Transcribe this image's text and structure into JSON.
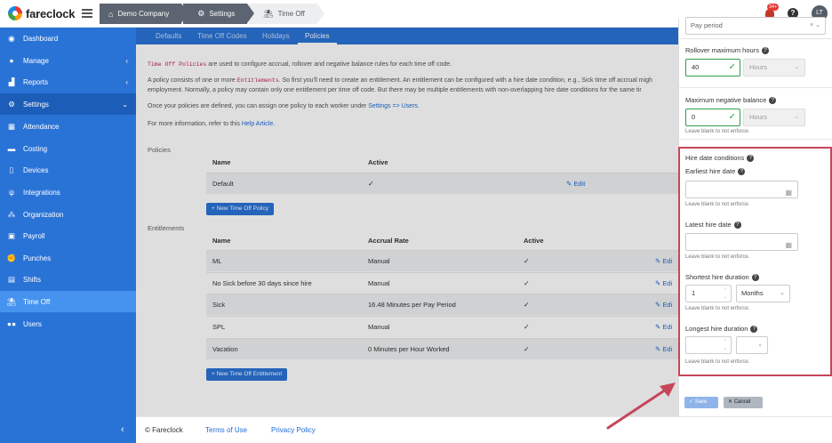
{
  "brand": {
    "name": "fareclock"
  },
  "breadcrumb": [
    {
      "label": "Demo Company",
      "icon": "home-icon"
    },
    {
      "label": "Settings",
      "icon": "gear-icon"
    },
    {
      "label": "Time Off",
      "icon": "beach-umbrella-icon"
    }
  ],
  "header": {
    "notification_count": "34+",
    "help": "?",
    "avatar_initials": "LT"
  },
  "sidebar": {
    "items": [
      {
        "label": "Dashboard",
        "icon": "dashboard-icon"
      },
      {
        "label": "Manage",
        "icon": "person-icon",
        "chevron": "‹"
      },
      {
        "label": "Reports",
        "icon": "chart-icon",
        "chevron": "‹"
      },
      {
        "label": "Settings",
        "icon": "gear-icon",
        "chevron": "⌄"
      },
      {
        "label": "Attendance",
        "icon": "calendar-icon"
      },
      {
        "label": "Costing",
        "icon": "folder-icon"
      },
      {
        "label": "Devices",
        "icon": "device-icon"
      },
      {
        "label": "Integrations",
        "icon": "plug-icon"
      },
      {
        "label": "Organization",
        "icon": "org-chart-icon"
      },
      {
        "label": "Payroll",
        "icon": "money-icon"
      },
      {
        "label": "Punches",
        "icon": "punch-icon"
      },
      {
        "label": "Shifts",
        "icon": "shifts-icon"
      },
      {
        "label": "Time Off",
        "icon": "beach-umbrella-icon"
      },
      {
        "label": "Users",
        "icon": "users-icon"
      }
    ],
    "collapse": "‹"
  },
  "tabs": [
    {
      "label": "Defaults"
    },
    {
      "label": "Time Off Codes"
    },
    {
      "label": "Holidays"
    },
    {
      "label": "Policies"
    }
  ],
  "intro": {
    "p1_code": "Time Off Policies",
    "p1_rest": " are used to configure accrual, rollover and negative balance rules for each time off code.",
    "p2_a": "A policy consists of one or more ",
    "p2_code": "Entitlements",
    "p2_b": ". So first you'll need to create an entitlement. An entitlement can be configured with a hire date condition, e.g., Sick time off accrual migh",
    "p2_line2": "employment. Normally, a policy may contain only one entitlement per time off code. But there may be multiple entitlements with non-overlapping hire date conditions for the same tir",
    "p3_a": "Once your policies are defined, you can assign one policy to each worker under ",
    "p3_link": "Settings => Users",
    "p3_b": ".",
    "p4_a": "For more information, refer to this ",
    "p4_link": "Help Article",
    "p4_b": "."
  },
  "policies": {
    "section_label": "Policies",
    "columns": [
      "Name",
      "Active"
    ],
    "rows": [
      {
        "name": "Default",
        "active": "✓",
        "edit": "Edit"
      }
    ],
    "new_button": "New Time Off Policy"
  },
  "entitlements": {
    "section_label": "Entitlements",
    "columns": [
      "Name",
      "Accrual Rate",
      "Active"
    ],
    "rows": [
      {
        "name": "ML",
        "accrual": "Manual",
        "active": "✓",
        "edit": "Edi"
      },
      {
        "name": "No Sick before 30 days since hire",
        "accrual": "Manual",
        "active": "✓",
        "edit": "Edi"
      },
      {
        "name": "Sick",
        "accrual": "16.48 Minutes per Pay Period",
        "active": "✓",
        "edit": "Edi"
      },
      {
        "name": "SPL",
        "accrual": "Manual",
        "active": "✓",
        "edit": "Edi"
      },
      {
        "name": "Vacation",
        "accrual": "0 Minutes per Hour Worked",
        "active": "✓",
        "edit": "Edi"
      }
    ],
    "new_button": "New Time Off Entitlement"
  },
  "footer": {
    "copyright": "© Fareclock",
    "terms": "Terms of Use",
    "privacy": "Privacy Policy"
  },
  "panel": {
    "top_select": "Pay period",
    "rollover_label": "Rollover maximum hours",
    "rollover_value": "40",
    "rollover_unit": "Hours",
    "negative_label": "Maximum negative balance",
    "negative_value": "0",
    "negative_unit": "Hours",
    "negative_hint": "Leave blank to not enforce.",
    "hire_title": "Hire date conditions",
    "earliest_label": "Earliest hire date",
    "earliest_hint": "Leave blank to not enforce.",
    "latest_label": "Latest hire date",
    "latest_hint": "Leave blank to not enforce.",
    "shortest_label": "Shortest hire duration",
    "shortest_value": "1",
    "shortest_unit": "Months",
    "shortest_hint": "Leave blank to not enforce.",
    "longest_label": "Longest hire duration",
    "longest_hint": "Leave blank to not enforce.",
    "save": "Save",
    "cancel": "Cancel"
  },
  "colors": {
    "sidebar": "#2a73d6",
    "highlight": "#c6465a",
    "valid": "#2e9e4f"
  }
}
